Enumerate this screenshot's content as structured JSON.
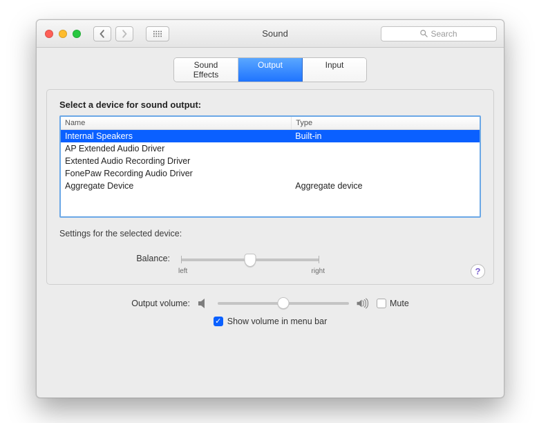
{
  "window": {
    "title": "Sound"
  },
  "toolbar": {
    "search_placeholder": "Search"
  },
  "tabs": {
    "sound_effects": "Sound Effects",
    "output": "Output",
    "input": "Input",
    "active": "output"
  },
  "panel": {
    "select_label": "Select a device for sound output:",
    "columns": {
      "name": "Name",
      "type": "Type"
    },
    "rows": [
      {
        "name": "Internal Speakers",
        "type": "Built-in",
        "selected": true
      },
      {
        "name": "AP Extended Audio Driver",
        "type": "",
        "selected": false
      },
      {
        "name": "Extented Audio Recording Driver",
        "type": "",
        "selected": false
      },
      {
        "name": "FonePaw Recording Audio Driver",
        "type": "",
        "selected": false
      },
      {
        "name": "Aggregate Device",
        "type": "Aggregate device",
        "selected": false
      }
    ],
    "settings_for": "Settings for the selected device:",
    "balance": {
      "label": "Balance:",
      "left": "left",
      "right": "right"
    }
  },
  "footer": {
    "output_volume_label": "Output volume:",
    "mute_label": "Mute",
    "show_label": "Show volume in menu bar"
  }
}
